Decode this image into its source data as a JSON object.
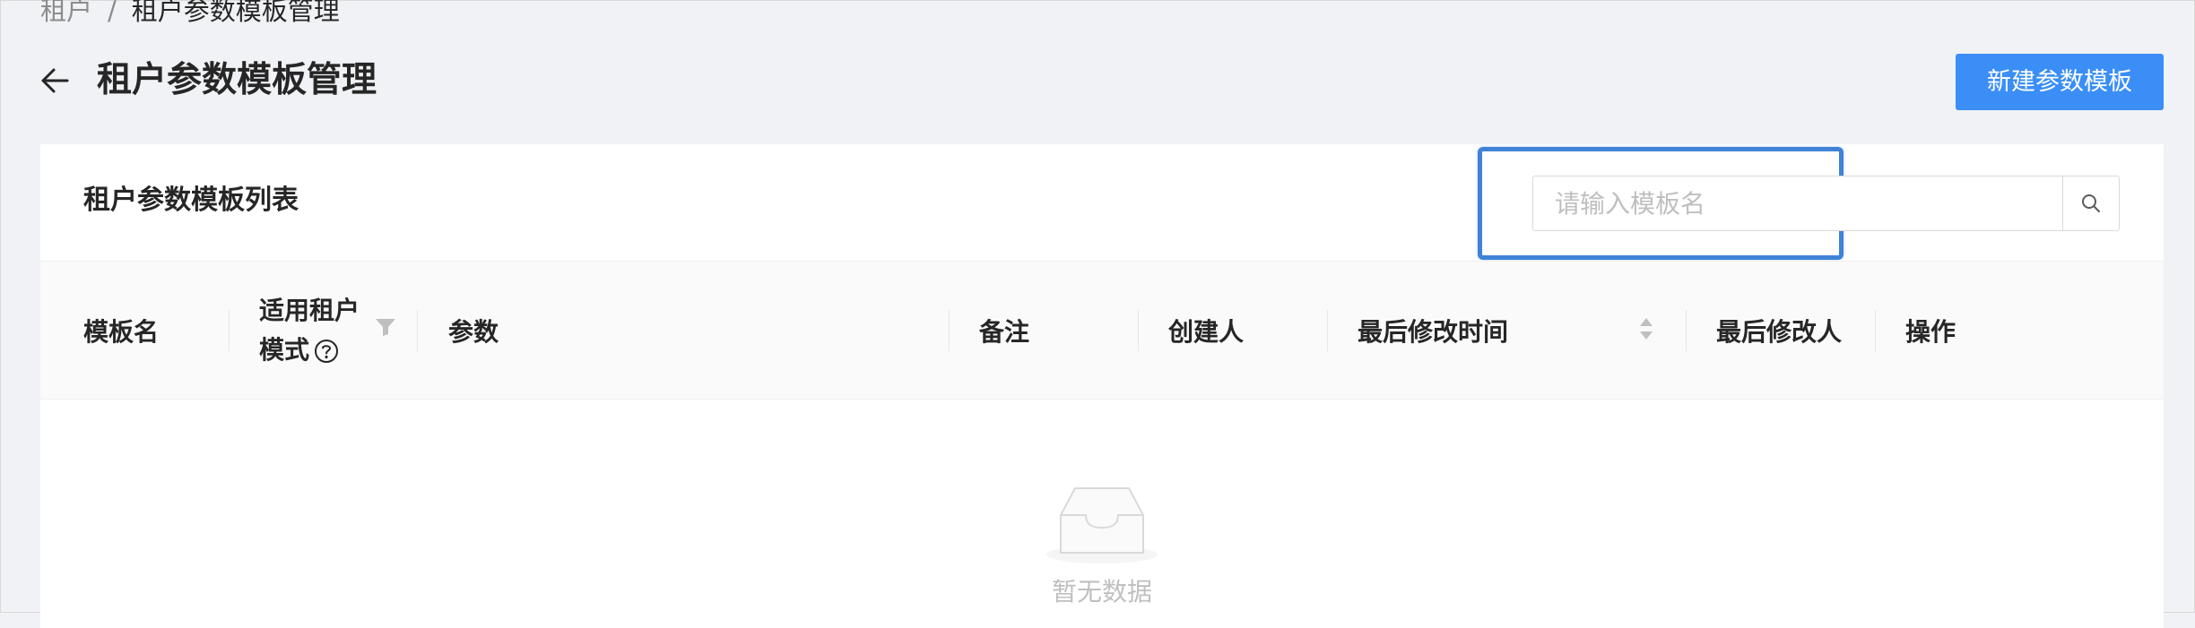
{
  "breadcrumb": {
    "parent": "租户",
    "separator": "/",
    "current": "租户参数模板管理"
  },
  "header": {
    "title": "租户参数模板管理",
    "new_button": "新建参数模板"
  },
  "card": {
    "title": "租户参数模板列表",
    "search": {
      "placeholder": "请输入模板名",
      "value": ""
    }
  },
  "table": {
    "columns": {
      "name": "模板名",
      "mode_line1": "适用租户",
      "mode_line2": "模式",
      "params": "参数",
      "remark": "备注",
      "creator": "创建人",
      "modified_time": "最后修改时间",
      "modifier": "最后修改人",
      "actions": "操作"
    },
    "rows": [],
    "empty_text": "暂无数据"
  },
  "colors": {
    "primary": "#3a8ef6",
    "highlight": "#3f82d6",
    "background": "#f0f2f5"
  }
}
